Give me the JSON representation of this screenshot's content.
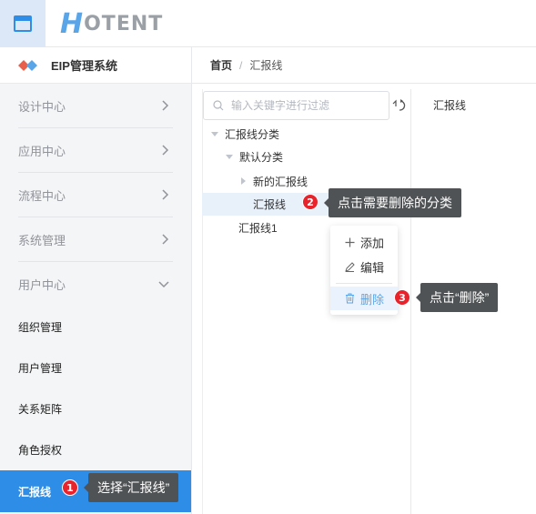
{
  "header": {
    "logo_h": "H",
    "logo_rest": "OTENT"
  },
  "sidebar": {
    "brand": "EIP管理系统",
    "sections": [
      {
        "label": "设计中心",
        "expanded": false
      },
      {
        "label": "应用中心",
        "expanded": false
      },
      {
        "label": "流程中心",
        "expanded": false
      },
      {
        "label": "系统管理",
        "expanded": false
      },
      {
        "label": "用户中心",
        "expanded": true
      }
    ],
    "sub_items": [
      {
        "label": "组织管理"
      },
      {
        "label": "用户管理"
      },
      {
        "label": "关系矩阵"
      },
      {
        "label": "角色授权"
      },
      {
        "label": "汇报线",
        "active": true
      }
    ]
  },
  "breadcrumb": {
    "home": "首页",
    "separator": "/",
    "current": "汇报线"
  },
  "search": {
    "placeholder": "输入关键字进行过滤",
    "value": ""
  },
  "tree": {
    "root": "汇报线分类",
    "default_category": "默认分类",
    "new_line": "新的汇报线",
    "selected": "汇报线",
    "line1": "汇报线1"
  },
  "content": {
    "label": "汇报线"
  },
  "context_menu": {
    "add": "添加",
    "edit": "编辑",
    "delete": "删除"
  },
  "annotations": {
    "step1": {
      "num": "1",
      "text": "选择“汇报线”"
    },
    "step2": {
      "num": "2",
      "text": "点击需要删除的分类"
    },
    "step3": {
      "num": "3",
      "text": "点击“删除”"
    }
  },
  "colors": {
    "accent": "#2e8de6",
    "badge": "#e8232b",
    "callout": "#505355"
  }
}
